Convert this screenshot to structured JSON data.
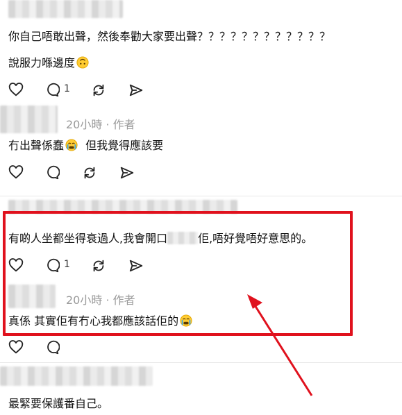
{
  "comments": [
    {
      "text": "你自己唔敢出聲，然後奉勸大家要出聲？？？？？？？？？？？？",
      "line2": "說服力喺邊度",
      "reply_count": "1"
    },
    {
      "time": "20小時",
      "dot": "·",
      "role": "作者",
      "text": "冇出聲係蠢",
      "text2": "但我覺得應該要"
    },
    {
      "text_a": "有啲人坐都坐得衰過人,我會開口",
      "text_b": "佢,唔好覺唔好意思的。",
      "reply_count": "1"
    },
    {
      "time": "20小時",
      "dot": "·",
      "role": "作者",
      "text": "真係 其實佢有冇心我都應該話佢的"
    },
    {
      "text": "最緊要保護番自己。"
    }
  ],
  "colors": {
    "highlight": "#e0111d",
    "arrow": "#e0111d",
    "meta": "#9a9a9a"
  },
  "icons": [
    "heart-icon",
    "comment-icon",
    "repost-icon",
    "share-icon",
    "crying-emoji-icon",
    "upside-down-face-emoji-icon"
  ]
}
